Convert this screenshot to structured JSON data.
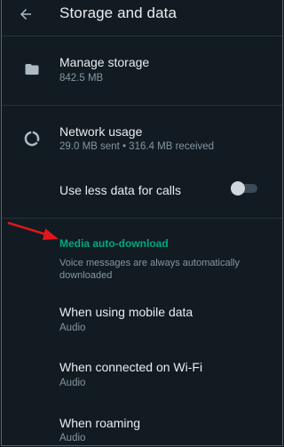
{
  "header": {
    "back_icon": "arrow-left-icon",
    "title": "Storage and data"
  },
  "storage": {
    "icon": "folder-icon",
    "title": "Manage storage",
    "subtitle": "842.5 MB"
  },
  "network": {
    "icon": "data-usage-icon",
    "title": "Network usage",
    "subtitle": "29.0 MB sent • 316.4 MB received"
  },
  "less_data": {
    "title": "Use less data for calls",
    "toggle_state": "off"
  },
  "media": {
    "header": "Media auto-download",
    "note": "Voice messages are always automatically downloaded",
    "items": [
      {
        "title": "When using mobile data",
        "value": "Audio"
      },
      {
        "title": "When connected on Wi-Fi",
        "value": "Audio"
      },
      {
        "title": "When roaming",
        "value": "Audio"
      }
    ]
  },
  "colors": {
    "background": "#121b22",
    "accent": "#00a884",
    "annotation_arrow": "#e0161b",
    "secondary_text": "#8696a0"
  }
}
